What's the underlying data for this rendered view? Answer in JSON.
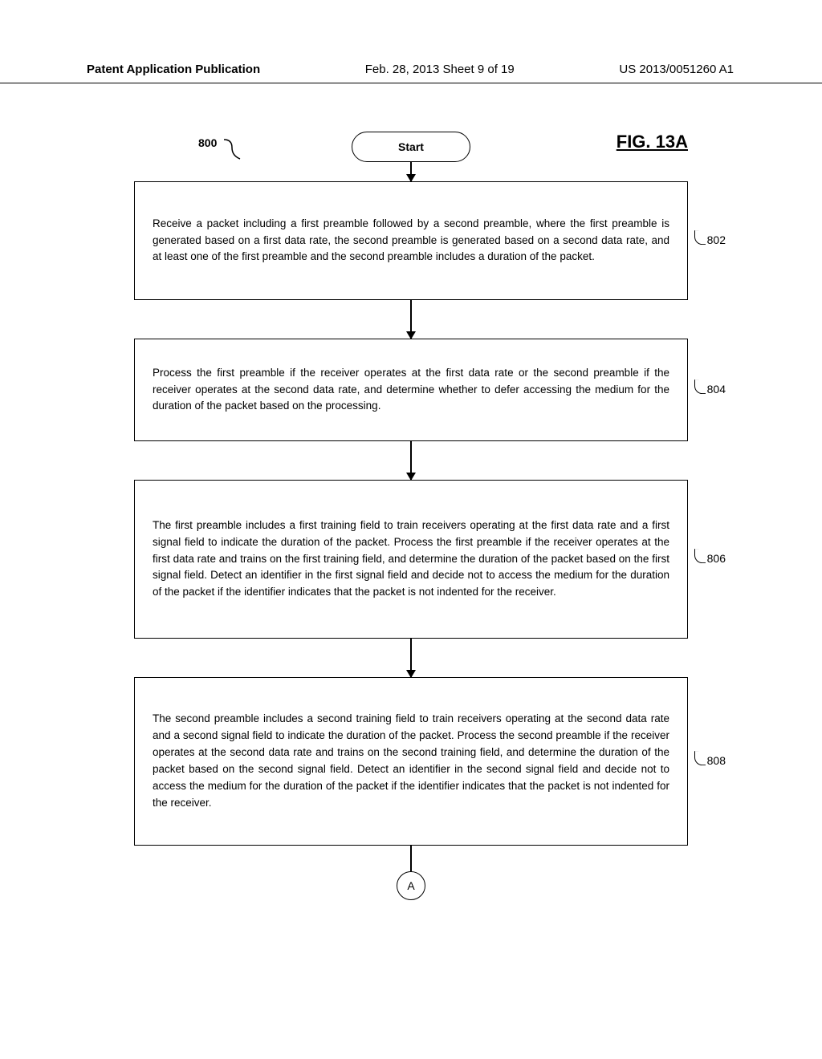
{
  "header": {
    "left": "Patent Application Publication",
    "center": "Feb. 28, 2013  Sheet 9 of 19",
    "right": "US 2013/0051260 A1"
  },
  "figure": {
    "label": "FIG. 13A",
    "flow_ref": "800",
    "start_label": "Start",
    "continuation": "A",
    "steps": [
      {
        "ref": "802",
        "text": "Receive a packet including a first preamble followed by a second preamble, where the first preamble is generated based on a first data rate, the second preamble is generated based on a second data rate, and at least one of the first preamble and the second preamble includes a duration of the packet."
      },
      {
        "ref": "804",
        "text": "Process the first preamble if the receiver operates at the first data rate or the second preamble if the receiver operates at the second data rate, and determine whether to defer accessing the medium for the duration of the packet based on the processing."
      },
      {
        "ref": "806",
        "text": "The first preamble includes a first training field to train receivers operating at the first data rate and a first signal field to indicate the duration of the packet. Process the first preamble if the receiver operates at the first data rate and trains on the first training field, and determine the duration of the packet based on the first signal field. Detect an identifier in the first signal field and decide not to access the medium for the duration of the packet if the identifier indicates that the packet is not indented for the receiver."
      },
      {
        "ref": "808",
        "text": "The second preamble includes a second training field to train receivers operating at the second data rate and a second signal field to indicate the duration of the packet. Process the second preamble if the receiver operates at the second data rate and trains on the second training field, and determine the duration of the packet based on the second signal field. Detect an identifier in the second signal field and decide not to access the medium for the duration of the packet if the identifier indicates that the packet is not indented for the receiver."
      }
    ]
  }
}
